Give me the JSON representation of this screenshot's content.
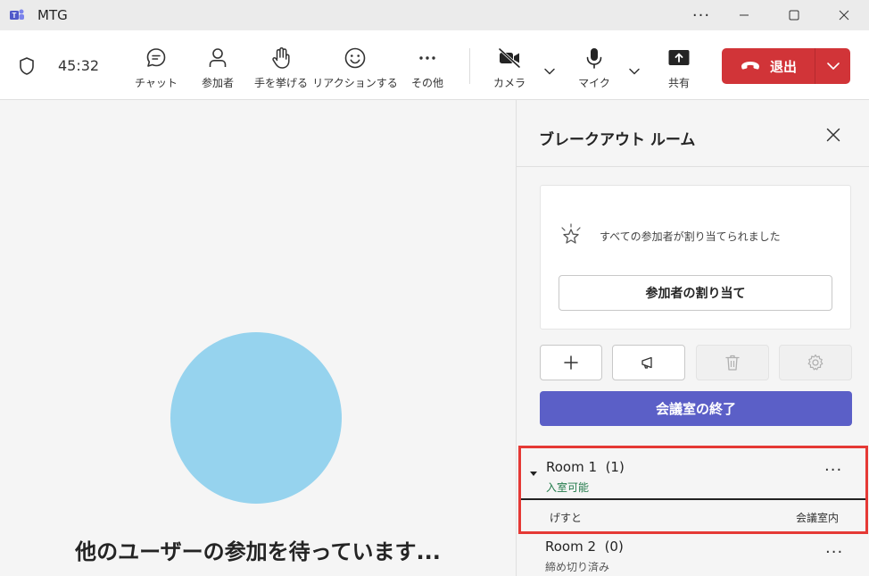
{
  "window": {
    "title": "MTG",
    "more_label": "···",
    "minimize": "—",
    "maximize": "☐",
    "close": "✕"
  },
  "toolbar": {
    "timer": "45:32",
    "items": [
      {
        "label": "チャット",
        "icon": "chat-icon"
      },
      {
        "label": "参加者",
        "icon": "people-icon"
      },
      {
        "label": "手を挙げる",
        "icon": "raise-hand-icon"
      },
      {
        "label": "リアクションする",
        "icon": "smiley-icon"
      },
      {
        "label": "その他",
        "icon": "more-icon"
      },
      {
        "label": "カメラ",
        "icon": "camera-off-icon"
      },
      {
        "label": "マイク",
        "icon": "mic-icon"
      },
      {
        "label": "共有",
        "icon": "share-icon"
      }
    ],
    "leave_label": "退出",
    "leave_color": "#d13438"
  },
  "stage": {
    "waiting_text": "他のユーザーの参加を待っています...",
    "avatar_color": "#96d3ee"
  },
  "panel": {
    "title": "ブレークアウト ルーム",
    "assign_message": "すべての参加者が割り当てられました",
    "assign_button": "参加者の割り当て",
    "end_button": "会議室の終了",
    "accent_color": "#5b5fc7",
    "rooms": [
      {
        "name": "Room 1",
        "count": "(1)",
        "status": "入室可能",
        "status_color": "#237b4b",
        "members": [
          {
            "name": "げすと",
            "status": "会議室内"
          }
        ]
      },
      {
        "name": "Room 2",
        "count": "(0)",
        "status": "締め切り済み"
      }
    ],
    "room_more": "···"
  }
}
